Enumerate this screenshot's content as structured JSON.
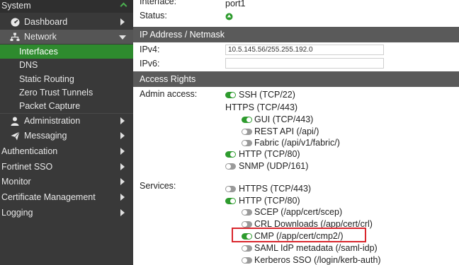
{
  "sidebar": {
    "system": "System",
    "items": [
      {
        "label": "Dashboard"
      },
      {
        "label": "Network"
      }
    ],
    "network_sub": [
      {
        "label": "Interfaces"
      },
      {
        "label": "DNS"
      },
      {
        "label": "Static Routing"
      },
      {
        "label": "Zero Trust Tunnels"
      },
      {
        "label": "Packet Capture"
      }
    ],
    "lower": [
      {
        "label": "Administration"
      },
      {
        "label": "Messaging"
      },
      {
        "label": "Authentication"
      },
      {
        "label": "Fortinet SSO"
      },
      {
        "label": "Monitor"
      },
      {
        "label": "Certificate Management"
      },
      {
        "label": "Logging"
      }
    ]
  },
  "main": {
    "interface_label": "Interface:",
    "interface_value": "port1",
    "status_label": "Status:",
    "ip_section": "IP Address / Netmask",
    "ipv4_label": "IPv4:",
    "ipv4_value": "10.5.145.56/255.255.192.0",
    "ipv6_label": "IPv6:",
    "ipv6_value": "",
    "access_section": "Access Rights",
    "admin_access_label": "Admin access:",
    "services_label": "Services:",
    "admin": {
      "ssh": "SSH (TCP/22)",
      "https": "HTTPS (TCP/443)",
      "gui": "GUI (TCP/443)",
      "rest": "REST API (/api/)",
      "fabric": "Fabric (/api/v1/fabric/)",
      "http": "HTTP (TCP/80)",
      "snmp": "SNMP (UDP/161)"
    },
    "services": {
      "https": "HTTPS (TCP/443)",
      "http": "HTTP (TCP/80)",
      "scep": "SCEP (/app/cert/scep)",
      "crl": "CRL Downloads (/app/cert/crl)",
      "cmp": "CMP (/app/cert/cmp2/)",
      "saml": "SAML IdP metadata (/saml-idp)",
      "kerberos": "Kerberos SSO (/login/kerb-auth)"
    }
  },
  "colors": {
    "sidebar_bg": "#393939",
    "active_green": "#2e8b2e",
    "toggle_on": "#2e9b2e",
    "section_header": "#5a5a5a",
    "highlight_red": "#d9262c"
  }
}
